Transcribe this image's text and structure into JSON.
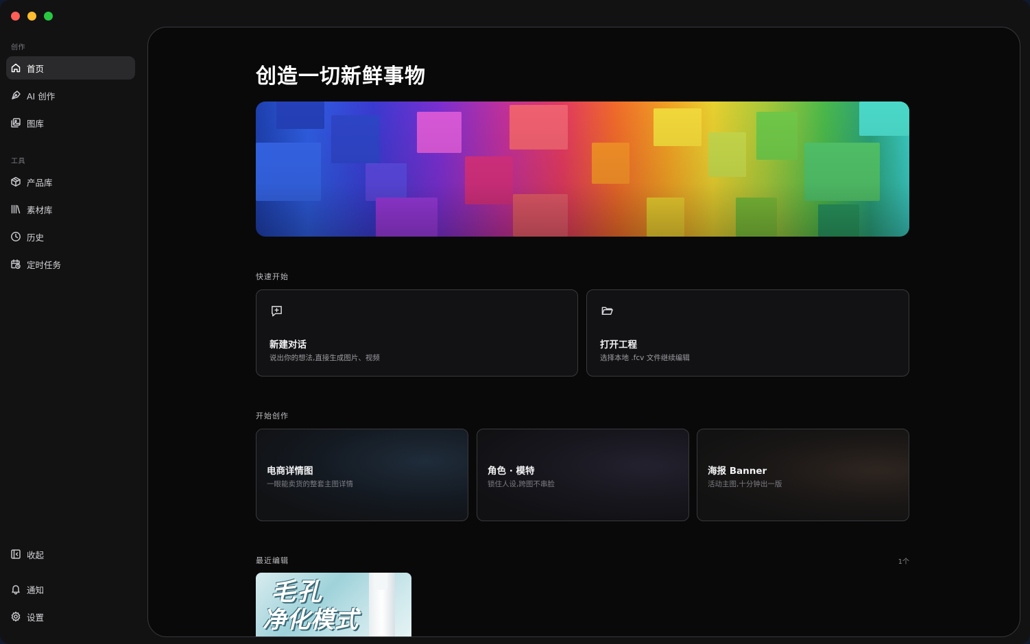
{
  "window": {
    "controls": [
      "close",
      "minimize",
      "zoom"
    ]
  },
  "sidebar": {
    "section_create": "创作",
    "section_tools": "工具",
    "items": [
      {
        "label": "首页",
        "icon": "home-icon",
        "active": true
      },
      {
        "label": "AI 创作",
        "icon": "pen-tool-icon"
      },
      {
        "label": "图库",
        "icon": "gallery-icon"
      },
      {
        "label": "产品库",
        "icon": "box-icon"
      },
      {
        "label": "素材库",
        "icon": "library-icon"
      },
      {
        "label": "历史",
        "icon": "clock-icon"
      },
      {
        "label": "定时任务",
        "icon": "calendar-clock-icon"
      }
    ],
    "collapse_label": "收起",
    "notify_label": "通知",
    "settings_label": "设置"
  },
  "main": {
    "title": "创造一切新鲜事物",
    "quick_start": {
      "title": "快速开始",
      "cards": [
        {
          "title": "新建对话",
          "subtitle": "说出你的想法,直接生成图片、视频",
          "icon": "message-plus-icon"
        },
        {
          "title": "打开工程",
          "subtitle": "选择本地 .fcv 文件继续编辑",
          "icon": "folder-open-icon"
        }
      ]
    },
    "start_create": {
      "title": "开始创作",
      "cards": [
        {
          "title": "电商详情图",
          "subtitle": "一眼能卖货的整套主图详情"
        },
        {
          "title": "角色 · 模特",
          "subtitle": "锁住人设,跨图不串脸"
        },
        {
          "title": "海报 Banner",
          "subtitle": "活动主图,十分钟出一版"
        }
      ]
    },
    "recent": {
      "title": "最近编辑",
      "count": "1个",
      "items": [
        {
          "thumb_text_line1": "毛孔",
          "thumb_text_line2": "净化模式"
        }
      ]
    }
  },
  "colors": {
    "window_bg": "#121213",
    "main_bg": "#090909",
    "border": "#3a3a3e",
    "active_nav": "#2a2a2d"
  }
}
